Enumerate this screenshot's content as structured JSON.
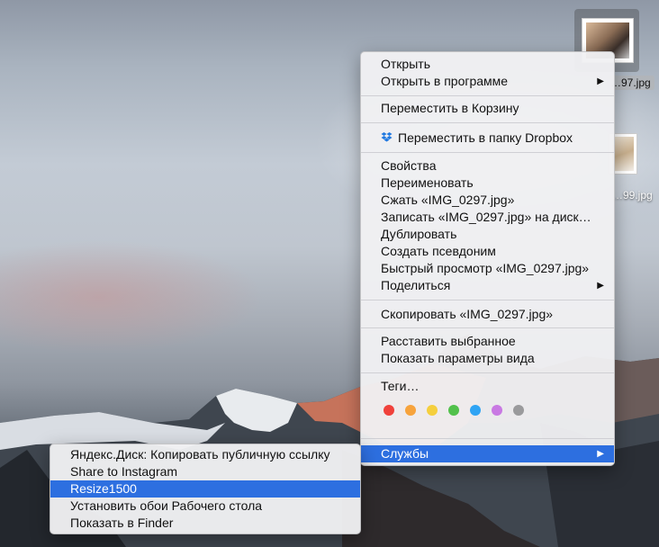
{
  "desktop": {
    "files": [
      {
        "name": "…97.jpg"
      },
      {
        "name": "…99.jpg"
      }
    ]
  },
  "context_menu": {
    "items": [
      {
        "label": "Открыть"
      },
      {
        "label": "Открыть в программе"
      },
      {
        "label": "Переместить в Корзину"
      },
      {
        "label": "Переместить в папку Dropbox",
        "icon": "dropbox-icon"
      },
      {
        "label": "Свойства"
      },
      {
        "label": "Переименовать"
      },
      {
        "label": "Сжать «IMG_0297.jpg»"
      },
      {
        "label": "Записать «IMG_0297.jpg» на диск…"
      },
      {
        "label": "Дублировать"
      },
      {
        "label": "Создать псевдоним"
      },
      {
        "label": "Быстрый просмотр «IMG_0297.jpg»"
      },
      {
        "label": "Поделиться"
      },
      {
        "label": "Скопировать «IMG_0297.jpg»"
      },
      {
        "label": "Расставить выбранное"
      },
      {
        "label": "Показать параметры вида"
      },
      {
        "label": "Теги…"
      },
      {
        "label": "Службы"
      }
    ],
    "tag_colors": [
      "#f0413b",
      "#f7a33c",
      "#f5cf3d",
      "#52c14b",
      "#2fa4f4",
      "#c979e3",
      "#9a9a9c"
    ],
    "selected_color": "#2d6fe0"
  },
  "services_menu": {
    "items": [
      {
        "label": "Яндекс.Диск: Копировать публичную ссылку"
      },
      {
        "label": "Share to Instagram"
      },
      {
        "label": "Resize1500"
      },
      {
        "label": "Установить обои Рабочего стола"
      },
      {
        "label": "Показать в Finder"
      }
    ]
  }
}
